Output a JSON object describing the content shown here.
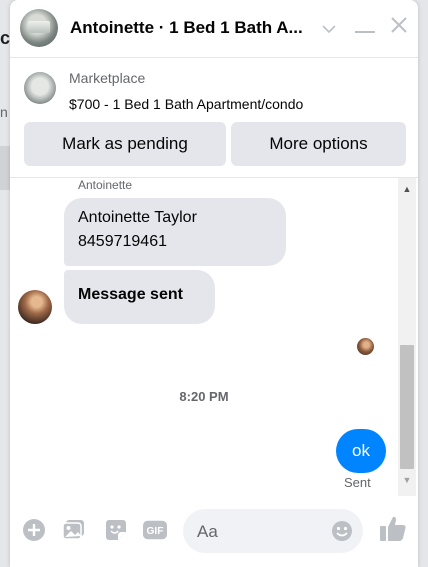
{
  "background": {
    "left_char": "c",
    "left_char2": "n"
  },
  "header": {
    "title": "Antoinette · 1 Bed 1 Bath A...",
    "icons": [
      "chevron-down-icon",
      "minimize-icon",
      "close-icon"
    ]
  },
  "marketplace": {
    "label": "Marketplace",
    "listing": "$700 - 1 Bed 1 Bath Apartment/condo",
    "buttons": {
      "pending": "Mark as pending",
      "more": "More options"
    }
  },
  "messages": {
    "sender_name": "Antoinette",
    "incoming": [
      {
        "line1": "Antoinette Taylor",
        "line2": "8459719461"
      },
      {
        "text": "Message sent"
      }
    ],
    "timestamp": "8:20 PM",
    "outgoing": {
      "text": "ok",
      "status": "Sent"
    }
  },
  "composer": {
    "placeholder": "Aa",
    "icons": [
      "plus-icon",
      "photo-icon",
      "sticker-icon",
      "gif-icon",
      "emoji-icon",
      "like-icon"
    ]
  },
  "colors": {
    "accent": "#0084ff",
    "icon_blue": "#0084ff",
    "bubble_gray": "#e4e6eb",
    "secondary_text": "#65676b"
  }
}
